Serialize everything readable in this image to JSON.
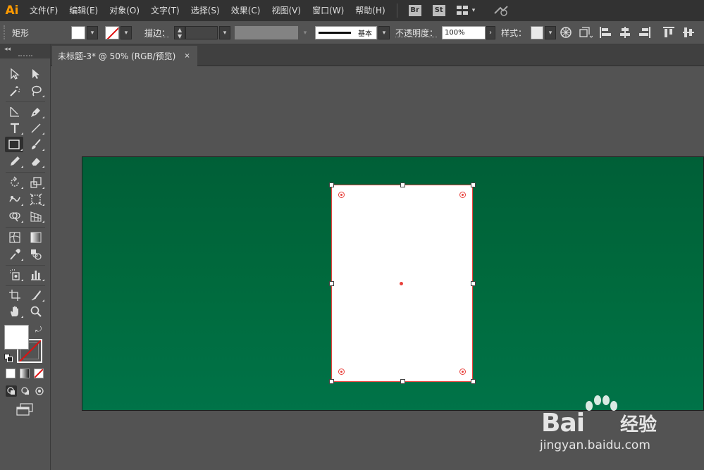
{
  "app": {
    "logo": "Ai",
    "menus": [
      "文件(F)",
      "编辑(E)",
      "对象(O)",
      "文字(T)",
      "选择(S)",
      "效果(C)",
      "视图(V)",
      "窗口(W)",
      "帮助(H)"
    ],
    "bridge_label": "Br",
    "stock_label": "St"
  },
  "control_bar": {
    "tool_name": "矩形",
    "stroke_label": "描边：",
    "stroke_profile_label": "基本",
    "opacity_label": "不透明度：",
    "opacity_value": "100%",
    "style_label": "样式："
  },
  "document": {
    "tab_title": "未标题-3* @ 50% (RGB/预览)",
    "tab_close": "×"
  },
  "colors": {
    "accent": "#ff9a00",
    "artboard_green": "#006a3d",
    "selection": "#e8413c",
    "fill": "#ffffff"
  },
  "watermark": {
    "brand": "Bai",
    "brand_suffix": "经验",
    "url": "jingyan.baidu.com"
  }
}
